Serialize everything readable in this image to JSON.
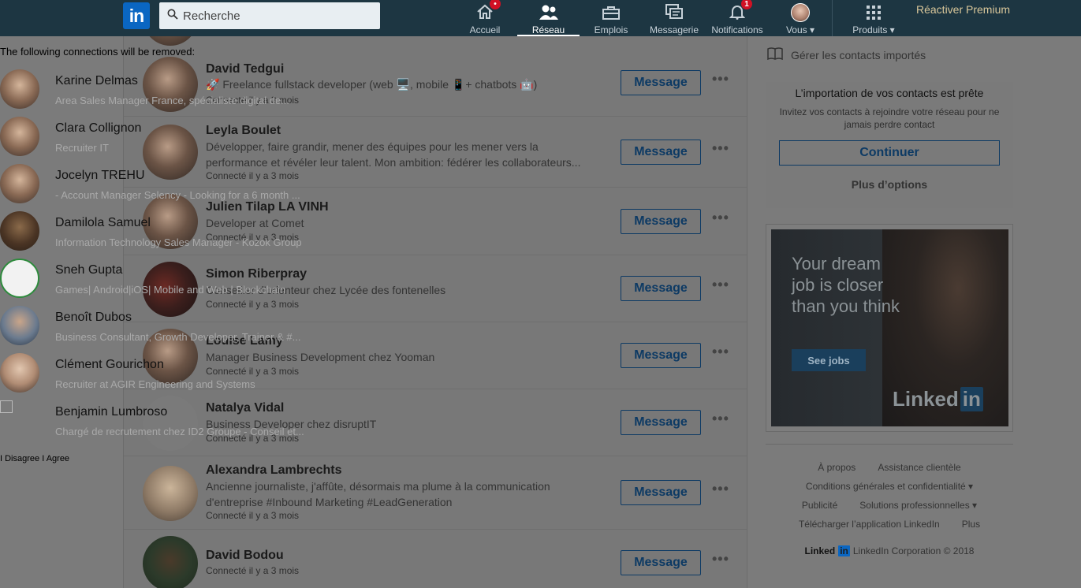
{
  "nav": {
    "logo": "in",
    "search_placeholder": "Recherche",
    "items": [
      {
        "label": "Accueil",
        "badge": "•"
      },
      {
        "label": "Réseau"
      },
      {
        "label": "Emplois"
      },
      {
        "label": "Messagerie"
      },
      {
        "label": "Notifications",
        "badge": "1"
      },
      {
        "label": "Vous ▾"
      },
      {
        "label": "Produits ▾"
      }
    ],
    "premium": "Réactiver Premium"
  },
  "connections": [
    {
      "name": "David Tedgui",
      "desc": "🚀 Freelance fullstack developer (web 🖥️, mobile 📱+ chatbots 🤖)",
      "connected": "Connecté il y a 3 mois",
      "button": "Message"
    },
    {
      "name": "Leyla Boulet",
      "desc": "Développer, faire grandir, mener des équipes pour les mener vers la performance et révéler leur talent. Mon ambition: fédérer les collaborateurs...",
      "connected": "Connecté il y a 3 mois",
      "button": "Message"
    },
    {
      "name": "Julien Tilap LA VINH",
      "desc": "Developer at Comet",
      "connected": "Connecté il y a 3 mois",
      "button": "Message"
    },
    {
      "name": "Simon Riberpray",
      "desc": "Conseiller d'orienteur chez Lycée des fontenelles",
      "connected": "Connecté il y a 3 mois",
      "button": "Message"
    },
    {
      "name": "Louise Lamy",
      "desc": "Manager Business Development chez Yooman",
      "connected": "Connecté il y a 3 mois",
      "button": "Message"
    },
    {
      "name": "Natalya Vidal",
      "desc": "Business Developer chez disruptIT",
      "connected": "Connecté il y a 3 mois",
      "button": "Message"
    },
    {
      "name": "Alexandra Lambrechts",
      "desc": "Ancienne journaliste, j'affûte, désormais ma plume à la communication d'entreprise #Inbound Marketing #LeadGeneration",
      "connected": "Connecté il y a 3 mois",
      "button": "Message"
    },
    {
      "name": "David Bodou",
      "desc": "",
      "connected": "Connecté il y a 3 mois",
      "button": "Message"
    }
  ],
  "overlay": {
    "title": "The following connections will be removed:",
    "people": [
      {
        "name": "Karine Delmas",
        "sub": "Area Sales Manager France, spécialiste digital de..."
      },
      {
        "name": "Clara Collignon",
        "sub": "Recruiter IT"
      },
      {
        "name": "Jocelyn TREHU",
        "sub": "- Account Manager Selency - Looking for a 6 month ..."
      },
      {
        "name": "Damilola Samuel",
        "sub": "Information Technology Sales Manager - Kozok Group"
      },
      {
        "name": "Sneh Gupta",
        "sub": "Games| Android|iOS| Mobile and Web | Blockchain"
      },
      {
        "name": "Benoît Dubos",
        "sub": "Business Consultant, Growth Developer, Trainer & #..."
      },
      {
        "name": "Clément Gourichon",
        "sub": "Recruiter at AGIR Engineering and Systems"
      },
      {
        "name": "Benjamin Lumbroso",
        "sub": "Chargé de recrutement chez ID2 Groupe - Conseil et..."
      }
    ],
    "footer": "I Disagree I Agree"
  },
  "right": {
    "manage": "Gérer les contacts importés",
    "import_title": "L’importation de vos contacts est prête",
    "import_desc": "Invitez vos contacts à rejoindre votre réseau pour ne jamais perdre contact",
    "continue": "Continuer",
    "more_options": "Plus d’options",
    "ad_text": "Your dream job is closer than you think",
    "ad_button": "See jobs",
    "ad_logo": "Linked",
    "ad_logo_in": "in",
    "footer_links": [
      [
        "À propos",
        "Assistance clientèle"
      ],
      [
        "Conditions générales et confidentialité ▾"
      ],
      [
        "Publicité",
        "Solutions professionnelles ▾"
      ],
      [
        "Télécharger l’application LinkedIn",
        "Plus"
      ]
    ],
    "copyright_brand": "Linked",
    "copyright_in": "in",
    "copyright": "LinkedIn Corporation © 2018"
  }
}
